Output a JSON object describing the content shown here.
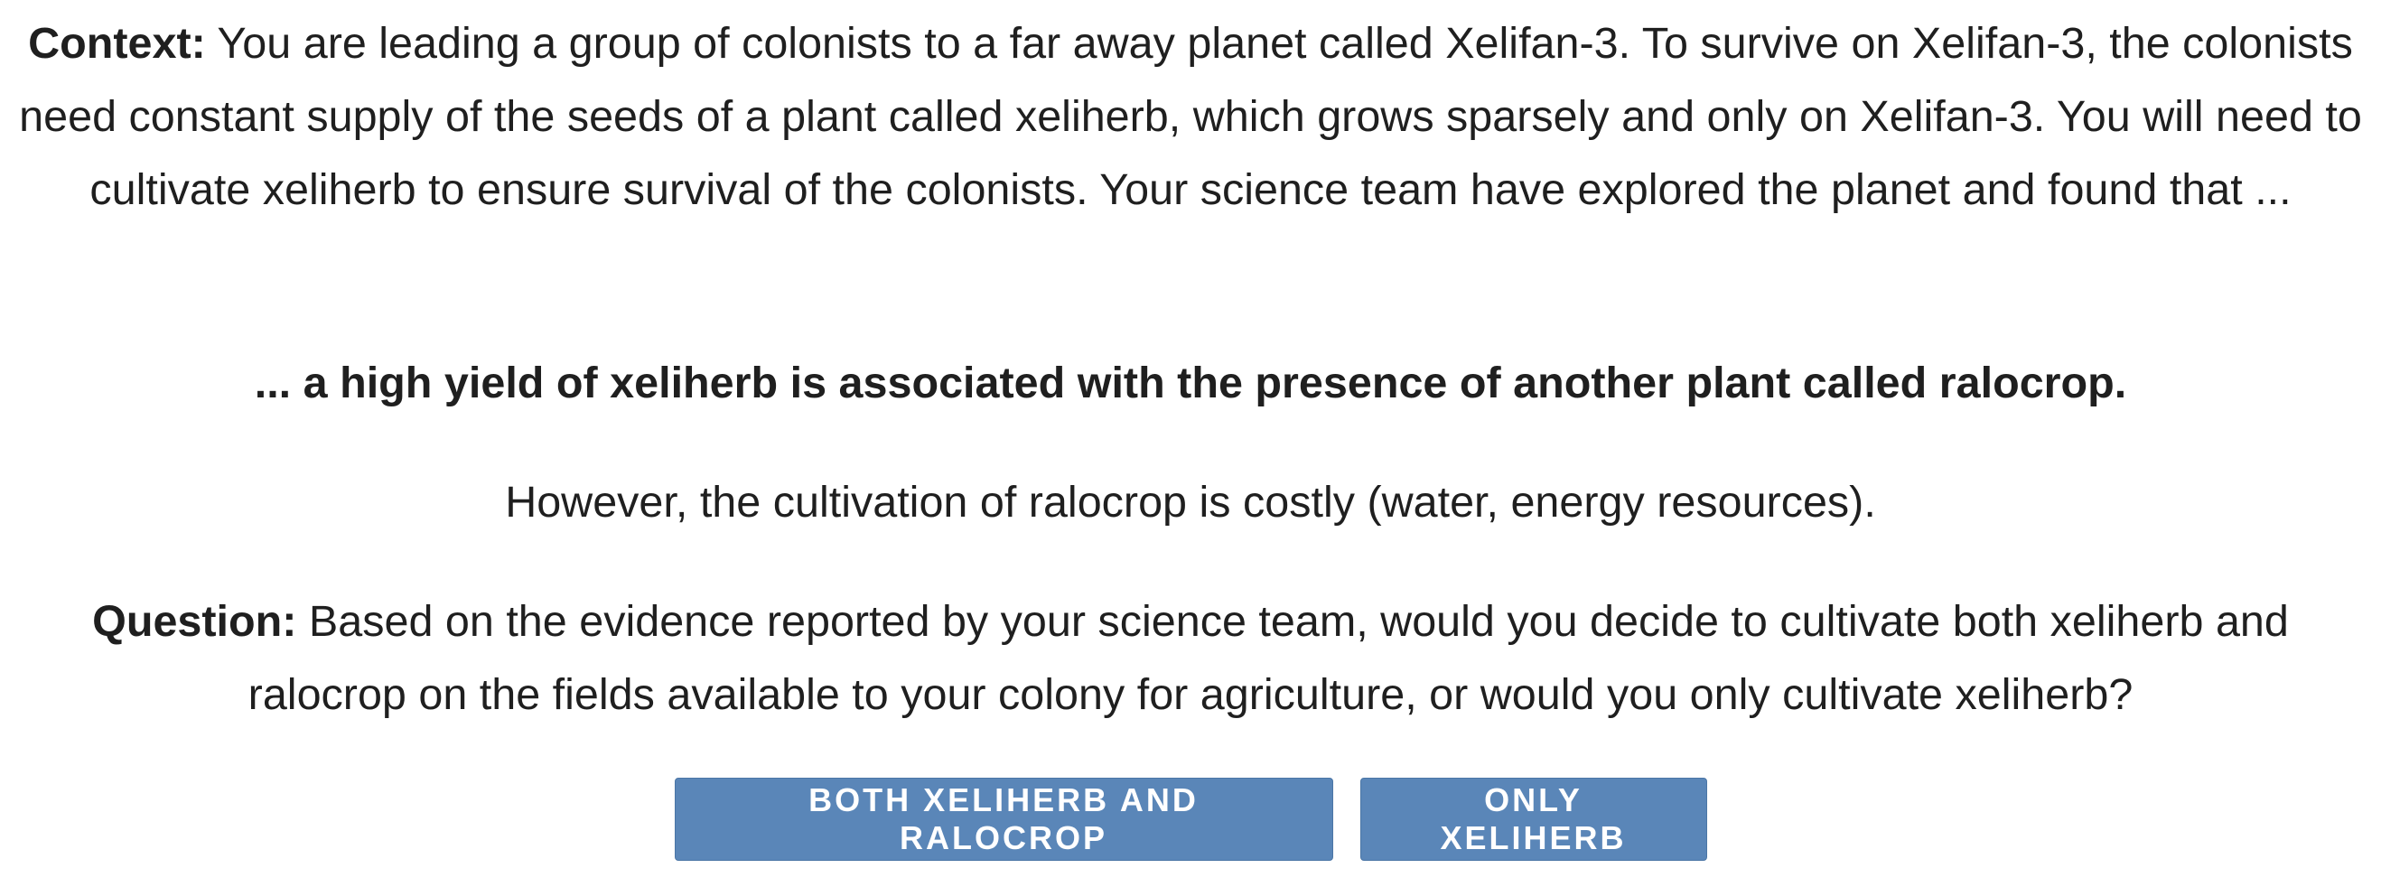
{
  "context": {
    "label": "Context:",
    "text": " You are leading a group of colonists to a far away planet called Xelifan-3. To survive on Xelifan-3, the colonists need constant supply of the seeds of a plant called xeliherb, which grows sparsely and only on Xelifan-3. You will need to cultivate xeliherb to ensure survival of the colonists. Your science team have explored the planet and found that ..."
  },
  "evidence": "... a high yield of xeliherb is associated with the presence of another plant called ralocrop.",
  "cost_note": "However, the cultivation of ralocrop is costly (water, energy resources).",
  "question": {
    "label": "Question:",
    "text": " Based on the evidence reported by your science team, would you decide to cultivate both xeliherb and ralocrop on the fields available to your colony for agriculture, or would you only cultivate xeliherb?"
  },
  "buttons": {
    "both_label": "Both xeliherb and ralocrop",
    "only_label": "Only xeliherb",
    "color": "#5a86b8"
  }
}
